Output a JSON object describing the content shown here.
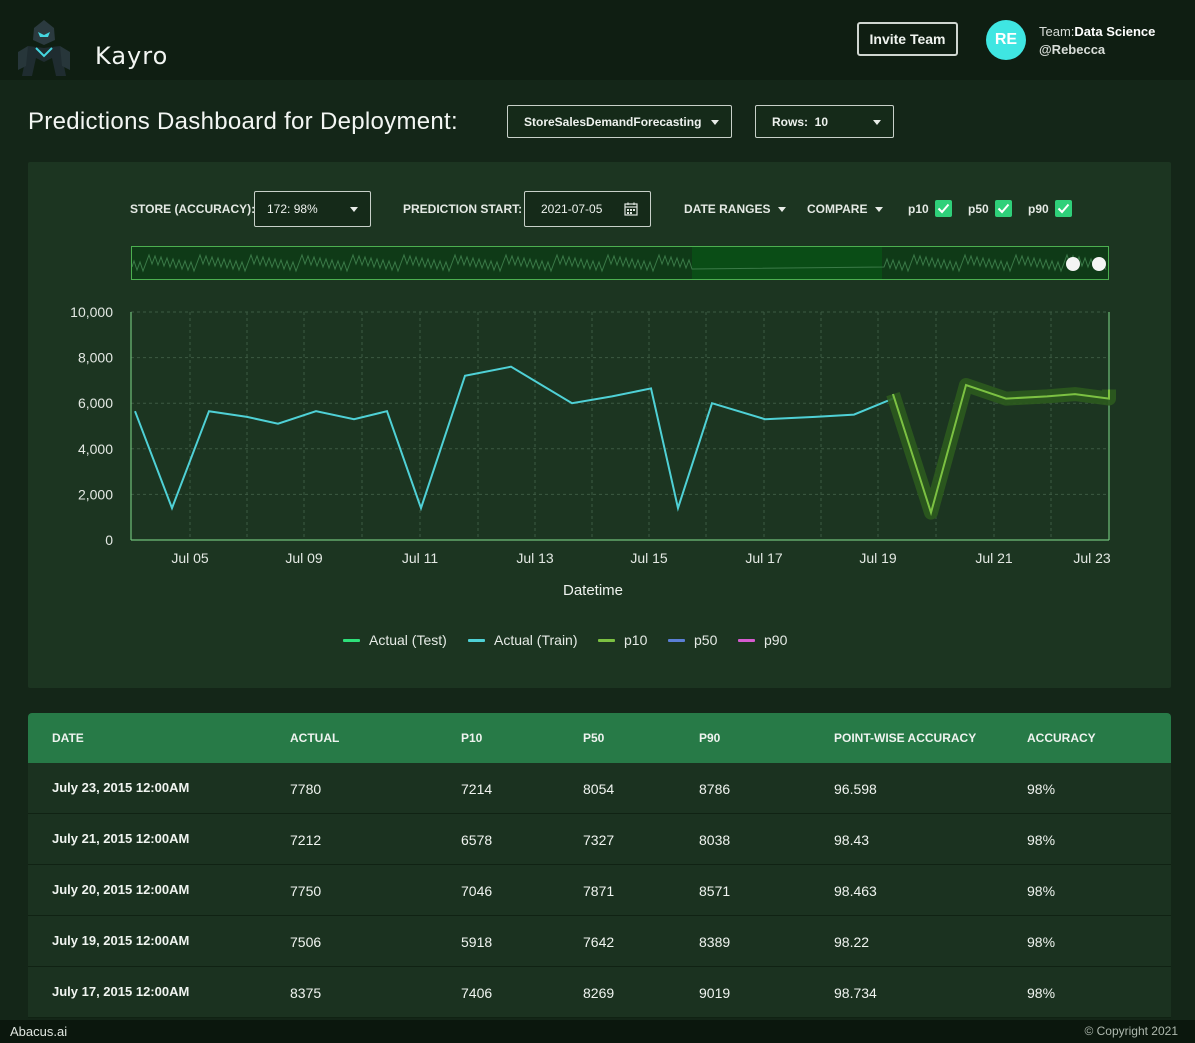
{
  "brand": {
    "name": "Kayro"
  },
  "header": {
    "invite_label": "Invite Team",
    "avatar_initials": "RE",
    "team_prefix": "Team:",
    "team_name": "Data Science",
    "username": "@Rebecca"
  },
  "page": {
    "title": "Predictions Dashboard for Deployment:",
    "deployment": "StoreSalesDemandForecasting",
    "rows": "Rows:  10"
  },
  "controls": {
    "store_label": "STORE (ACCURACY):",
    "store_value": "172: 98%",
    "prediction_start_label": "PREDICTION START:",
    "prediction_start_value": "2021-07-05",
    "date_ranges_label": "DATE RANGES",
    "compare_label": "COMPARE",
    "p10_label": "p10",
    "p50_label": "p50",
    "p90_label": "p90",
    "p10_checked": true,
    "p50_checked": true,
    "p90_checked": true
  },
  "chart_data": {
    "type": "line",
    "xlabel": "Datetime",
    "ylabel": "",
    "ylim": [
      0,
      10000
    ],
    "yticks": [
      "10,000",
      "8,000",
      "6,000",
      "4,000",
      "2,000",
      "0"
    ],
    "xticks": [
      "Jul 05",
      "Jul 09",
      "Jul 11",
      "Jul 13",
      "Jul 15",
      "Jul 17",
      "Jul 19",
      "Jul 21",
      "Jul 23"
    ],
    "grid": true,
    "legend_position": "bottom",
    "series": [
      {
        "name": "Actual (Test)",
        "color": "#2ee07a",
        "values": []
      },
      {
        "name": "Actual (Train)",
        "color": "#4fd1d6",
        "values": [
          5650,
          1400,
          5650,
          5400,
          5100,
          5650,
          5300,
          5650,
          1400,
          7200,
          7600,
          6000,
          6300,
          6650,
          1400,
          6000,
          5300,
          5400,
          5500,
          6200,
          6400
        ]
      },
      {
        "name": "p10",
        "color": "#7cc142",
        "values": [
          6400,
          1200,
          6800,
          6200,
          6300,
          6400,
          6200,
          6600
        ]
      },
      {
        "name": "p50",
        "color": "#5b7fd6",
        "values": []
      },
      {
        "name": "p90",
        "color": "#d65bd0",
        "values": []
      }
    ]
  },
  "table": {
    "headers": [
      "DATE",
      "ACTUAL",
      "P10",
      "P50",
      "P90",
      "POINT-WISE ACCURACY",
      "ACCURACY"
    ],
    "rows": [
      [
        "July 23, 2015 12:00AM",
        "7780",
        "7214",
        "8054",
        "8786",
        "96.598",
        "98%"
      ],
      [
        "July 21, 2015 12:00AM",
        "7212",
        "6578",
        "7327",
        "8038",
        "98.43",
        "98%"
      ],
      [
        "July 20, 2015 12:00AM",
        "7750",
        "7046",
        "7871",
        "8571",
        "98.463",
        "98%"
      ],
      [
        "July 19, 2015 12:00AM",
        "7506",
        "5918",
        "7642",
        "8389",
        "98.22",
        "98%"
      ],
      [
        "July 17, 2015 12:00AM",
        "8375",
        "7406",
        "8269",
        "9019",
        "98.734",
        "98%"
      ]
    ]
  },
  "footer": {
    "left": "Abacus.ai",
    "right": "© Copyright 2021"
  },
  "colors": {
    "accent": "#2fd07a",
    "table_header": "#277a47",
    "background": "#142618"
  },
  "icons": {
    "logo": "robot-logo-icon",
    "calendar": "calendar-icon",
    "checkbox": "checkbox-checked-icon"
  }
}
